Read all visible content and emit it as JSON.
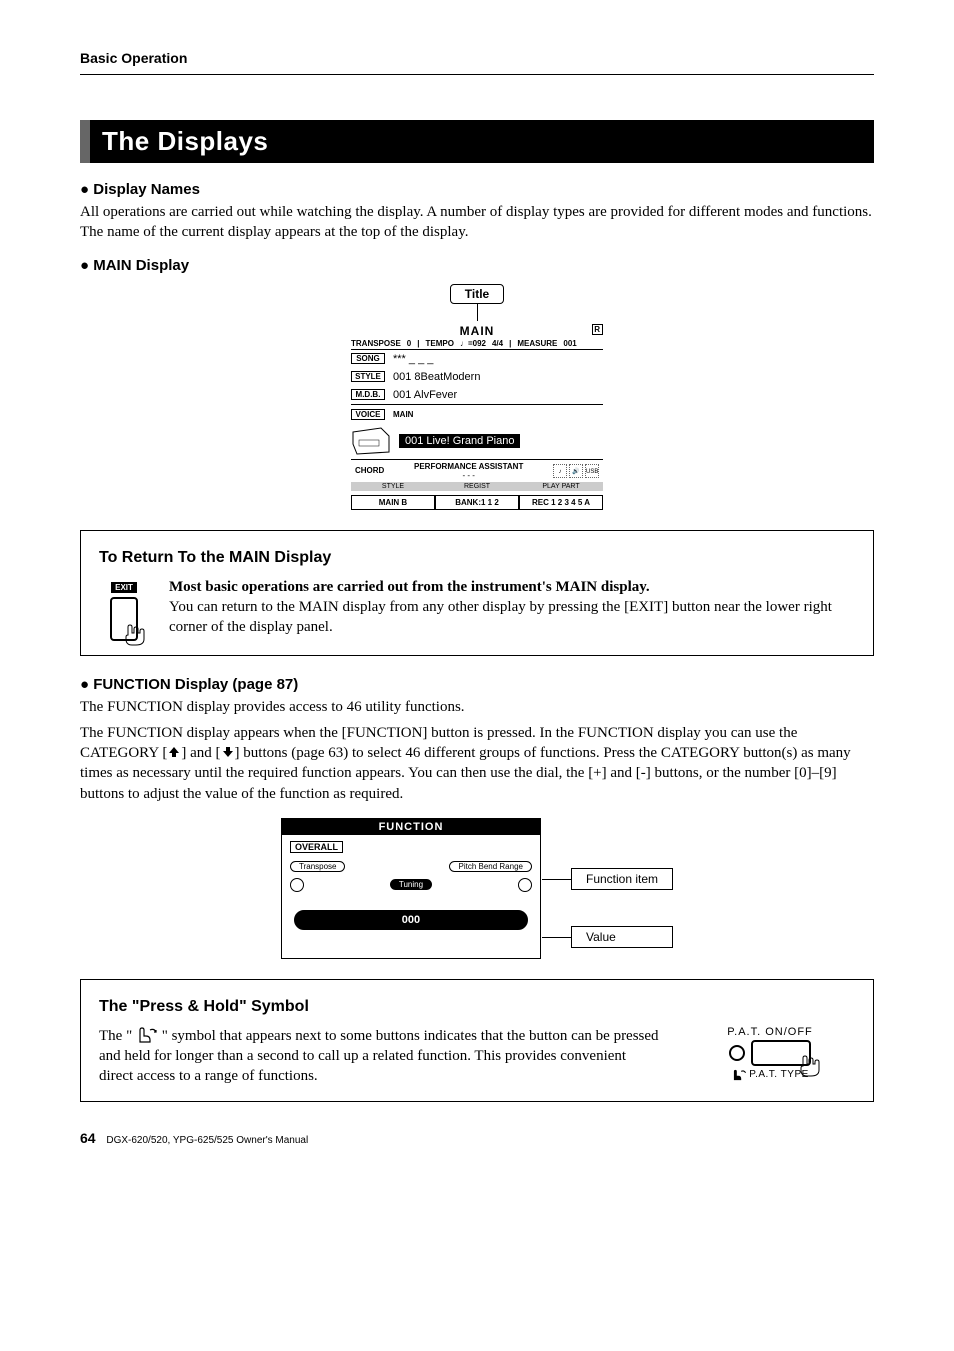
{
  "header": {
    "section": "Basic Operation"
  },
  "banner": {
    "title": "The Displays"
  },
  "displayNames": {
    "heading": "Display Names",
    "body": "All operations are carried out while watching the display. A number of display types are provided for different modes and functions. The name of the current display appears at the top of the display."
  },
  "mainDisplay": {
    "heading": "MAIN Display",
    "titleLabel": "Title",
    "lcd": {
      "title": "MAIN",
      "transposeLabel": "TRANSPOSE",
      "transposeVal": "0",
      "tempoLabel": "TEMPO",
      "tempoVal": "♩=092",
      "timeSig": "4/4",
      "measureLabel": "MEASURE",
      "measureVal": "001",
      "songTag": "SONG",
      "songVal": "*** _ _ _",
      "styleTag": "STYLE",
      "styleVal": "001 8BeatModern",
      "mdbTag": "M.D.B.",
      "mdbVal": "001 AlvFever",
      "voiceTag": "VOICE",
      "voiceLabel": "MAIN",
      "voiceVal": "001 Live! Grand Piano",
      "chordLabel": "CHORD",
      "perfLabel": "PERFORMANCE ASSISTANT",
      "perfVal": "- - -",
      "usb": "USB",
      "footerHeaders": [
        "STYLE",
        "REGIST",
        "PLAY PART"
      ],
      "footerStyle": "MAIN B",
      "footerRegist": "BANK:1   1  2",
      "footerPlay": "REC 1 2 3 4 5 A"
    }
  },
  "returnBox": {
    "title": "To Return To the MAIN Display",
    "exitLabel": "EXIT",
    "bold": "Most basic operations are carried out from the instrument's MAIN display.",
    "body": "You can return to the MAIN display from any other display by pressing the [EXIT] button near the lower right corner of the display panel."
  },
  "functionDisplay": {
    "heading": "FUNCTION Display (page 87)",
    "line1": "The FUNCTION display provides access to 46 utility functions.",
    "line2a": "The FUNCTION display appears when the [FUNCTION] button is pressed. In the FUNCTION display you can use the CATEGORY [",
    "line2b": "] and [",
    "line2c": "] buttons (page 63) to select 46 different groups of functions. Press the CATEGORY button(s) as many times as necessary until the required function appears. You can then use the dial, the [+] and [-] buttons, or the number [0]–[9] buttons to adjust the value of the function as required.",
    "lcd": {
      "title": "FUNCTION",
      "overall": "OVERALL",
      "left": "Transpose",
      "center": "Tuning",
      "right": "Pitch Bend Range",
      "value": "000"
    },
    "callout1": "Function item",
    "callout2": "Value"
  },
  "pressHold": {
    "title": "The \"Press & Hold\" Symbol",
    "textA": "The \" ",
    "textB": " \" symbol that appears next to some buttons indicates that the button can be pressed and held for longer than a second to call up a related function. This provides convenient direct access to a range of functions.",
    "patOnOff": "P.A.T. ON/OFF",
    "patType": "P.A.T. TYPE"
  },
  "footer": {
    "page": "64",
    "manual": "DGX-620/520, YPG-625/525  Owner's Manual"
  }
}
